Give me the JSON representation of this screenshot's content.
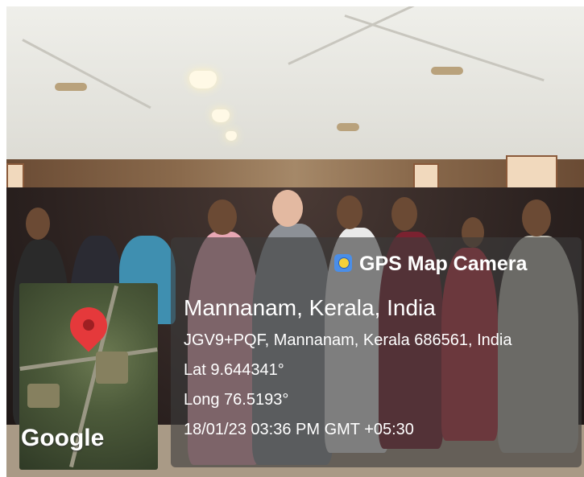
{
  "app": {
    "name": "GPS Map Camera",
    "icon": "gps-camera-icon"
  },
  "location": {
    "place": "Mannanam, Kerala, India",
    "address": "JGV9+PQF, Mannanam, Kerala 686561, India",
    "lat": "Lat 9.644341°",
    "long": "Long 76.5193°",
    "datetime": "18/01/23 03:36 PM GMT +05:30"
  },
  "map": {
    "attribution": "Google",
    "marker": "location-pin-icon"
  }
}
